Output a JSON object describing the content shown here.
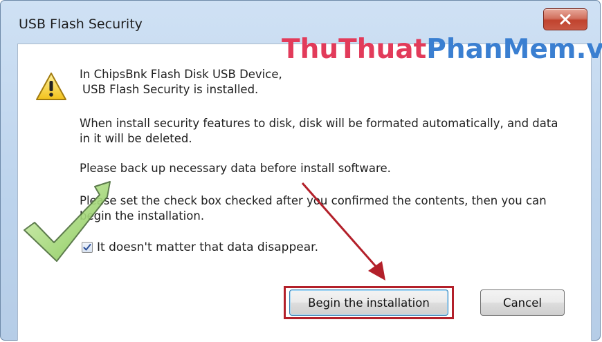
{
  "window": {
    "title": "USB Flash Security"
  },
  "watermark": {
    "part1": "ThuThuat",
    "part2": "PhanMem.vn"
  },
  "message": {
    "line1": "In ChipsBnk Flash Disk USB Device,",
    "line1b": "USB Flash Security is installed.",
    "line2a": "When install security features to disk, disk will be formated automatically, and data",
    "line2b": "in it will be deleted.",
    "line3": "Please back up necessary data before install software.",
    "line4a": "Please set the check box checked after you confirmed the contents, then you can",
    "line4b": "begin the installation."
  },
  "checkbox": {
    "label": "It doesn't matter that data disappear.",
    "checked": true
  },
  "buttons": {
    "begin": "Begin the installation",
    "cancel": "Cancel"
  },
  "colors": {
    "highlight": "#b3202a",
    "arrow": "#b3202a",
    "checkmark": "#8fd25b"
  }
}
